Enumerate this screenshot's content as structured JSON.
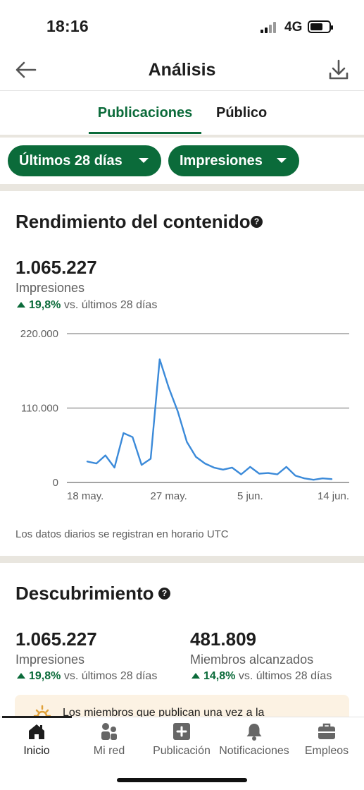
{
  "status_bar": {
    "time": "18:16",
    "network": "4G"
  },
  "header": {
    "title": "Análisis"
  },
  "tabs": [
    {
      "label": "Publicaciones",
      "active": true
    },
    {
      "label": "Público",
      "active": false
    }
  ],
  "filters": {
    "period": "Últimos 28 días",
    "metric": "Impresiones"
  },
  "content_performance": {
    "title": "Rendimiento del contenido",
    "help_glyph": "?",
    "total": "1.065.227",
    "total_label": "Impresiones",
    "delta_pct": "19,8%",
    "delta_text": "vs. últimos 28 días",
    "footnote": "Los datos diarios se registran en horario UTC"
  },
  "chart_data": {
    "type": "line",
    "ylim": [
      0,
      220000
    ],
    "y_ticks": [
      {
        "value": 0,
        "label": "0"
      },
      {
        "value": 110000,
        "label": "110.000"
      },
      {
        "value": 220000,
        "label": "220.000"
      }
    ],
    "x_ticks": [
      {
        "index": 0,
        "label": "18 may."
      },
      {
        "index": 9,
        "label": "27 may."
      },
      {
        "index": 18,
        "label": "5 jun."
      },
      {
        "index": 27,
        "label": "14 jun."
      }
    ],
    "x": [
      "18 may.",
      "19 may.",
      "20 may.",
      "21 may.",
      "22 may.",
      "23 may.",
      "24 may.",
      "25 may.",
      "26 may.",
      "27 may.",
      "28 may.",
      "29 may.",
      "30 may.",
      "31 may.",
      "1 jun.",
      "2 jun.",
      "3 jun.",
      "4 jun.",
      "5 jun.",
      "6 jun.",
      "7 jun.",
      "8 jun.",
      "9 jun.",
      "10 jun.",
      "11 jun.",
      "12 jun.",
      "13 jun.",
      "14 jun."
    ],
    "values": [
      31000,
      28000,
      40000,
      22000,
      73000,
      67000,
      26000,
      35000,
      182000,
      140000,
      105000,
      60000,
      38000,
      28000,
      22000,
      19000,
      22000,
      12000,
      23000,
      13000,
      14000,
      12000,
      23000,
      10000,
      6000,
      4000,
      6000,
      5000
    ],
    "color": "#3b8ad9",
    "grid": true
  },
  "discovery": {
    "title": "Descubrimiento",
    "help_glyph": "?",
    "metrics": [
      {
        "value": "1.065.227",
        "label": "Impresiones",
        "delta_pct": "19,8%",
        "delta_text": "vs. últimos 28 días"
      },
      {
        "value": "481.809",
        "label": "Miembros alcanzados",
        "delta_pct": "14,8%",
        "delta_text": "vs. últimos 28 días"
      }
    ],
    "tip": "Los miembros que publican una vez a la"
  },
  "bottom_nav": [
    {
      "label": "Inicio",
      "icon": "home-icon",
      "active": true
    },
    {
      "label": "Mi red",
      "icon": "people-icon",
      "active": false
    },
    {
      "label": "Publicación",
      "icon": "plus-square-icon",
      "active": false
    },
    {
      "label": "Notificaciones",
      "icon": "bell-icon",
      "active": false
    },
    {
      "label": "Empleos",
      "icon": "briefcase-icon",
      "active": false
    }
  ],
  "colors": {
    "brand_green": "#0b6b3a",
    "line_blue": "#3b8ad9",
    "divider": "#e9e6df",
    "tip_bg": "#fcf2e3"
  }
}
